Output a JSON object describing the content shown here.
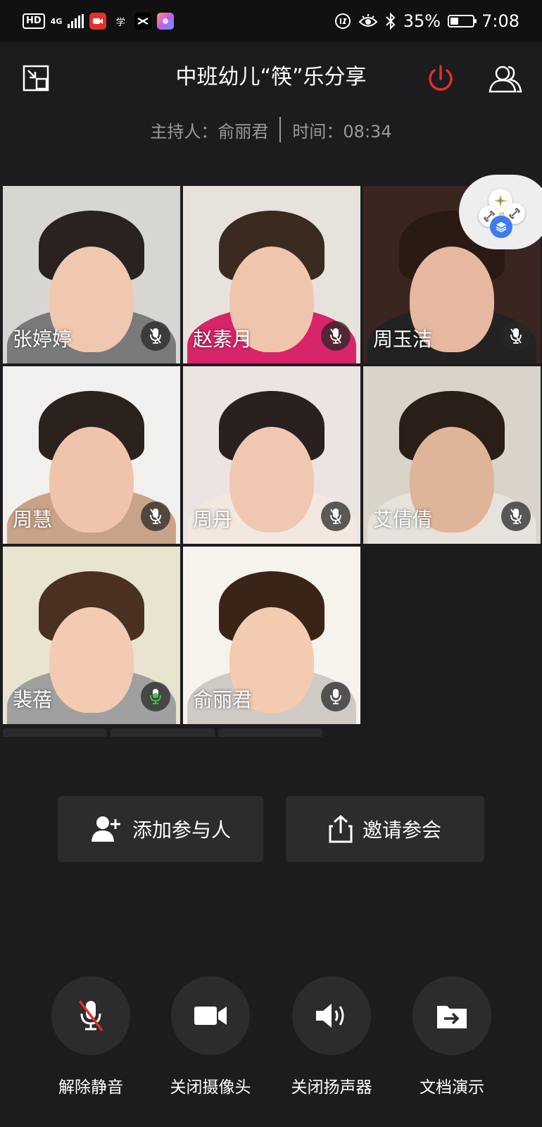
{
  "status_bar": {
    "hd": "HD",
    "network": "4G",
    "battery_percent": "35%",
    "battery_level": 0.35,
    "time": "7:08",
    "icons": [
      "signal-icon",
      "video-app-icon",
      "study-app-icon",
      "capcut-icon",
      "gallery-icon",
      "data-saver-icon",
      "eye-comfort-icon",
      "bluetooth-icon",
      "battery-icon"
    ]
  },
  "header": {
    "title": "中班幼儿“筷”乐分享",
    "host_label": "主持人：",
    "host_name": "俞丽君",
    "time_label": "时间：",
    "elapsed": "08:34"
  },
  "participants": [
    {
      "name": "张婷婷",
      "mic": "muted",
      "bg": "#d8d6d2",
      "skin": "#f0c8b0",
      "hair": "#2a2220",
      "shirt": "#7a7a7a"
    },
    {
      "name": "赵素月",
      "mic": "muted",
      "bg": "#e7e3dc",
      "skin": "#efc6ad",
      "hair": "#3a2a20",
      "shirt": "#d8246a"
    },
    {
      "name": "周玉洁",
      "mic": "muted",
      "bg": "#3a2520",
      "skin": "#e6b8a0",
      "hair": "#2a1a14",
      "shirt": "#222222"
    },
    {
      "name": "周慧",
      "mic": "muted",
      "bg": "#f2f0ee",
      "skin": "#f0c4aa",
      "hair": "#2b221e",
      "shirt": "#c9a388"
    },
    {
      "name": "周丹",
      "mic": "muted",
      "bg": "#ebe4e2",
      "skin": "#f0c8b2",
      "hair": "#2a2020",
      "shirt": "#f2e8e0"
    },
    {
      "name": "艾倩倩",
      "mic": "muted",
      "bg": "#d9d3c9",
      "skin": "#e0b498",
      "hair": "#2a1e18",
      "shirt": "#e6e2dc"
    },
    {
      "name": "裴蓓",
      "mic": "speaking",
      "bg": "#e9e4cf",
      "skin": "#f2cbb2",
      "hair": "#4a3020",
      "shirt": "#a0a0a0"
    },
    {
      "name": "俞丽君",
      "mic": "on",
      "bg": "#f6f2ec",
      "skin": "#f2cbb0",
      "hair": "#3a2418",
      "shirt": "#cfcac4"
    }
  ],
  "actions": {
    "add_participant": "添加参与人",
    "invite": "邀请参会"
  },
  "controls": {
    "unmute": "解除静音",
    "camera_off": "关闭摄像头",
    "speaker_off": "关闭扬声器",
    "doc_present": "文档演示"
  },
  "colors": {
    "background": "#1c1c1e",
    "button_bg": "#2c2c2e",
    "power_red": "#e0302a",
    "speaking_green": "#3ec94a",
    "muted_slash_red": "#e0302a",
    "widget_blue": "#3d7bf0"
  }
}
